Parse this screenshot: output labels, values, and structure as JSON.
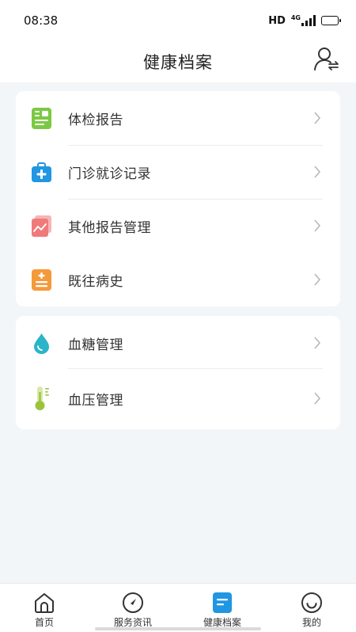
{
  "status_bar": {
    "time": "08:38",
    "hd": "HD",
    "network": "4G"
  },
  "header": {
    "title": "健康档案",
    "switch_icon": "user-switch-icon"
  },
  "groups": [
    {
      "items": [
        {
          "label": "体检报告",
          "icon": "checkup-report-icon",
          "color": "#7ac943"
        },
        {
          "label": "门诊就诊记录",
          "icon": "medical-kit-icon",
          "color": "#2196e3"
        },
        {
          "label": "其他报告管理",
          "icon": "report-chart-icon",
          "color": "#f07a7a"
        },
        {
          "label": "既往病史",
          "icon": "medical-history-icon",
          "color": "#f59a3b"
        }
      ]
    },
    {
      "items": [
        {
          "label": "血糖管理",
          "icon": "blood-drop-icon",
          "color": "#2bb5c9"
        },
        {
          "label": "血压管理",
          "icon": "thermometer-icon",
          "color": "#9bc43c"
        }
      ]
    }
  ],
  "tabbar": {
    "tabs": [
      {
        "label": "首页",
        "icon": "home-icon"
      },
      {
        "label": "服务资讯",
        "icon": "compass-icon"
      },
      {
        "label": "健康档案",
        "icon": "records-icon",
        "active": true,
        "color": "#2196e3"
      },
      {
        "label": "我的",
        "icon": "smile-face-icon"
      }
    ]
  }
}
